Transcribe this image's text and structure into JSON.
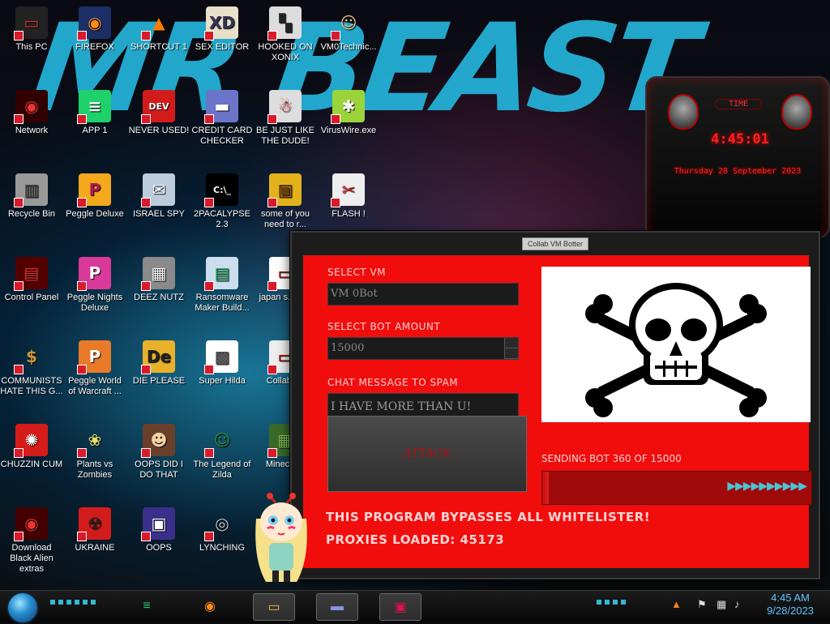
{
  "desktop": {
    "banner_text": "MR BEAST",
    "icons": [
      {
        "label": "This PC",
        "glyph": "▭",
        "bg": "#222",
        "fg": "#d33"
      },
      {
        "label": "FIREFOX",
        "glyph": "◉",
        "bg": "#1b2f66",
        "fg": "#ff8a1c"
      },
      {
        "label": "SHORTCUT 1",
        "glyph": "▲",
        "bg": "transparent",
        "fg": "#ff7b00"
      },
      {
        "label": "SEX EDITOR",
        "glyph": "XD",
        "bg": "#e8e0c8",
        "fg": "#335"
      },
      {
        "label": "HOOKED ON XONIX",
        "glyph": "▚",
        "bg": "#ddd",
        "fg": "#222"
      },
      {
        "label": "VM0Technic...",
        "glyph": "☺",
        "bg": "transparent",
        "fg": "#f3c08a"
      },
      {
        "label": "Network",
        "glyph": "◉",
        "bg": "#300",
        "fg": "#e33"
      },
      {
        "label": "APP 1",
        "glyph": "≡",
        "bg": "#1fd16b",
        "fg": "#fff"
      },
      {
        "label": "NEVER USED!",
        "glyph": "DEV",
        "bg": "#d21c1c",
        "fg": "#fff"
      },
      {
        "label": "CREDIT CARD CHECKER",
        "glyph": "▬",
        "bg": "#6a74c9",
        "fg": "#fff"
      },
      {
        "label": "BE JUST LIKE THE DUDE!",
        "glyph": "☃",
        "bg": "#ddd",
        "fg": "#c22"
      },
      {
        "label": "VirusWire.exe",
        "glyph": "✱",
        "bg": "#9bd43a",
        "fg": "#fff"
      },
      {
        "label": "Recycle Bin",
        "glyph": "▥",
        "bg": "#999",
        "fg": "#444"
      },
      {
        "label": "Peggle Deluxe",
        "glyph": "P",
        "bg": "#f4a81b",
        "fg": "#b0165a"
      },
      {
        "label": "ISRAEL SPY",
        "glyph": "✉",
        "bg": "#bcd",
        "fg": "#fff"
      },
      {
        "label": "2PACALYPSE 2.3",
        "glyph": "C:\\_",
        "bg": "#000",
        "fg": "#fff"
      },
      {
        "label": "some of you need to r...",
        "glyph": "▣",
        "bg": "#e3b21b",
        "fg": "#6a3c10"
      },
      {
        "label": "FLASH !",
        "glyph": "✂",
        "bg": "#eee",
        "fg": "#c22"
      },
      {
        "label": "Control Panel",
        "glyph": "▤",
        "bg": "#500",
        "fg": "#e33"
      },
      {
        "label": "Peggle Nights Deluxe",
        "glyph": "P",
        "bg": "#d93a9a",
        "fg": "#fff"
      },
      {
        "label": "DEEZ NUTZ",
        "glyph": "▦",
        "bg": "#8a8a8a",
        "fg": "#fff"
      },
      {
        "label": "Ransomware Maker Build...",
        "glyph": "▤",
        "bg": "#cde",
        "fg": "#2a6"
      },
      {
        "label": "japan s... sim",
        "glyph": "▭",
        "bg": "#fff",
        "fg": "#a00"
      },
      {
        "label": "COMMUNISTS HATE THIS G...",
        "glyph": "$",
        "bg": "transparent",
        "fg": "#c99a3a"
      },
      {
        "label": "Peggle World of Warcraft ...",
        "glyph": "P",
        "bg": "#e87a2a",
        "fg": "#fff"
      },
      {
        "label": "DIE PLEASE",
        "glyph": "De",
        "bg": "#e9b12a",
        "fg": "#222"
      },
      {
        "label": "Super Hilda",
        "glyph": "▩",
        "bg": "#fff",
        "fg": "#555"
      },
      {
        "label": "CollabV...",
        "glyph": "▭",
        "bg": "#eee",
        "fg": "#a00"
      },
      {
        "label": "CHUZZIN CUM",
        "glyph": "✺",
        "bg": "#d61b1b",
        "fg": "#fff"
      },
      {
        "label": "Plants vs Zombies",
        "glyph": "❀",
        "bg": "transparent",
        "fg": "#e6e36a"
      },
      {
        "label": "OOPS DID I DO THAT",
        "glyph": "☻",
        "bg": "#6a3f2a",
        "fg": "#f3d2a5"
      },
      {
        "label": "The Legend of Zilda",
        "glyph": "☺",
        "bg": "transparent",
        "fg": "#2f8a3a"
      },
      {
        "label": "Minecra...",
        "glyph": "▦",
        "bg": "#3a6a2a",
        "fg": "#8c5"
      },
      {
        "label": "Download Black Alien extras",
        "glyph": "◉",
        "bg": "#400",
        "fg": "#e33"
      },
      {
        "label": "UKRAINE",
        "glyph": "☢",
        "bg": "#d21c1c",
        "fg": "#222"
      },
      {
        "label": "OOPS",
        "glyph": "▣",
        "bg": "#3a2f8a",
        "fg": "#fff"
      },
      {
        "label": "LYNCHING",
        "glyph": "◎",
        "bg": "transparent",
        "fg": "#ccc"
      }
    ]
  },
  "clock_widget": {
    "title": "TIME",
    "time": "4:45:01",
    "date": "Thursday 28 September 2023"
  },
  "window": {
    "title": "Collab VM Botter",
    "select_vm_label": "SELECT VM",
    "select_vm_value": "VM 0Bot",
    "bot_amount_label": "SELECT BOT AMOUNT",
    "bot_amount_value": "15000",
    "chat_label": "CHAT MESSAGE TO SPAM",
    "chat_value": "I HAVE MORE THAN U!",
    "attack_label": "ATTACK",
    "status_text": "SENDING BOT 360 OF 15000",
    "progress": 0.024,
    "progress_arrows": "▶▶▶▶▶▶▶▶▶▶",
    "line1": "THIS PROGRAM BYPASSES ALL WHITELISTER!",
    "line2": "PROXIES LOADED: 45173"
  },
  "taskbar": {
    "time": "4:45 AM",
    "date": "9/28/2023"
  }
}
